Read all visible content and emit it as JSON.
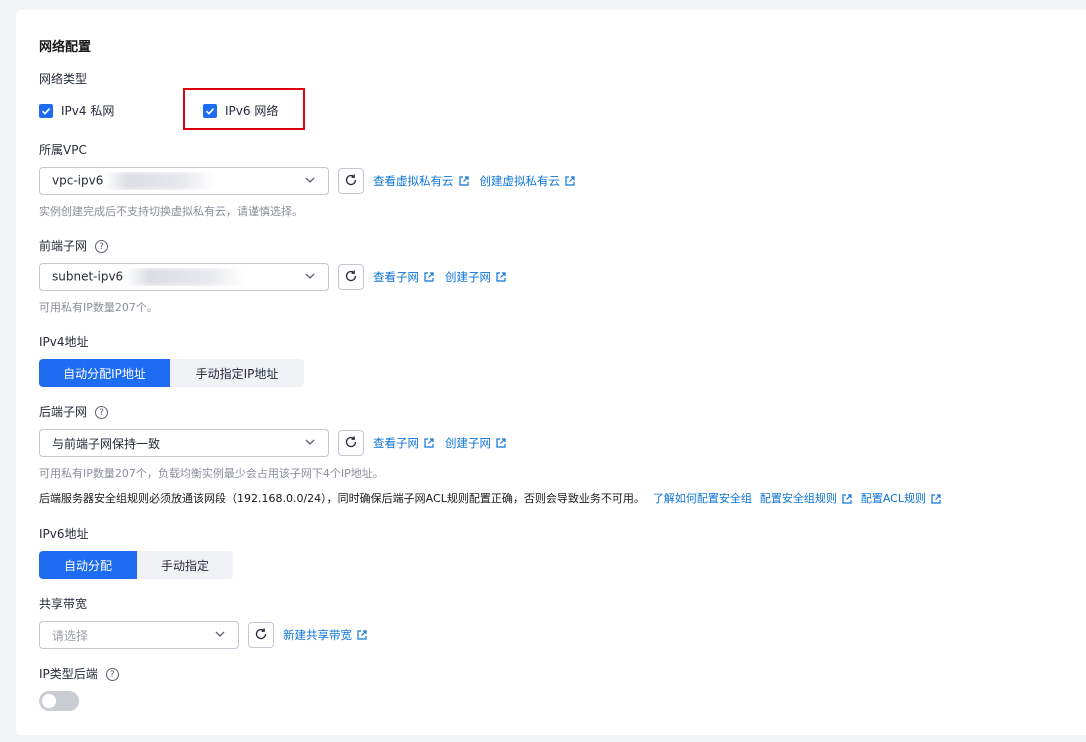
{
  "section_title": "网络配置",
  "network_type": {
    "label": "网络类型",
    "ipv4_label": "IPv4 私网",
    "ipv6_label": "IPv6 网络"
  },
  "vpc": {
    "label": "所属VPC",
    "value": "vpc-ipv6",
    "link_view": "查看虚拟私有云",
    "link_create": "创建虚拟私有云",
    "hint": "实例创建完成后不支持切换虚拟私有云，请谨慎选择。"
  },
  "frontend_subnet": {
    "label": "前端子网",
    "value": "subnet-ipv6",
    "link_view": "查看子网",
    "link_create": "创建子网",
    "hint": "可用私有IP数量207个。"
  },
  "ipv4_address": {
    "label": "IPv4地址",
    "option_auto": "自动分配IP地址",
    "option_manual": "手动指定IP地址"
  },
  "backend_subnet": {
    "label": "后端子网",
    "value": "与前端子网保持一致",
    "link_view": "查看子网",
    "link_create": "创建子网",
    "hint": "可用私有IP数量207个，负载均衡实例最少会占用该子网下4个IP地址。",
    "warning": "后端服务器安全组规则必须放通该网段（192.168.0.0/24），同时确保后端子网ACL规则配置正确，否则会导致业务不可用。",
    "link_learn": "了解如何配置安全组",
    "link_sg": "配置安全组规则",
    "link_acl": "配置ACL规则"
  },
  "ipv6_address": {
    "label": "IPv6地址",
    "option_auto": "自动分配",
    "option_manual": "手动指定"
  },
  "shared_bandwidth": {
    "label": "共享带宽",
    "placeholder": "请选择",
    "link_create": "新建共享带宽"
  },
  "ip_type_backend": {
    "label": "IP类型后端"
  },
  "colors": {
    "primary": "#1e6cf2",
    "link": "#0d74d8",
    "highlight_border": "#e0000b"
  }
}
